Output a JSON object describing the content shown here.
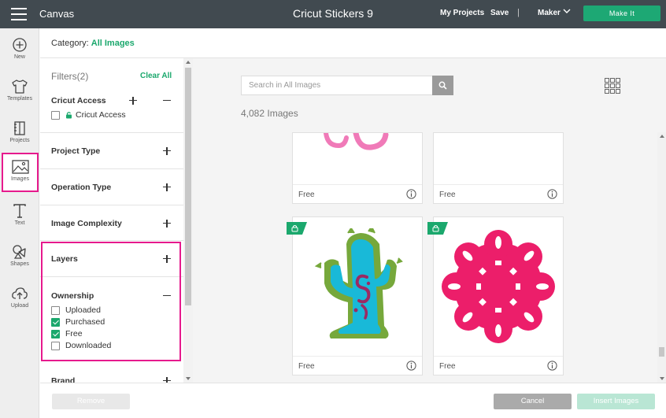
{
  "topbar": {
    "app_name": "Canvas",
    "doc_title": "Cricut Stickers 9",
    "my_projects": "My Projects",
    "save": "Save",
    "separator": "|",
    "machine": "Maker",
    "make_it": "Make It"
  },
  "rail": {
    "items": [
      {
        "label": "New",
        "icon": "plus-circle-icon"
      },
      {
        "label": "Templates",
        "icon": "shirt-icon"
      },
      {
        "label": "Projects",
        "icon": "notebook-icon"
      },
      {
        "label": "Images",
        "icon": "image-icon",
        "active": true
      },
      {
        "label": "Text",
        "icon": "text-icon"
      },
      {
        "label": "Shapes",
        "icon": "shapes-icon"
      },
      {
        "label": "Upload",
        "icon": "cloud-upload-icon"
      }
    ]
  },
  "category": {
    "label": "Category:",
    "value": "All Images"
  },
  "filters": {
    "title": "Filters(2)",
    "clear_all": "Clear All",
    "cricut_access": {
      "title": "Cricut Access",
      "option": "Cricut Access",
      "checked": false
    },
    "project_type": "Project Type",
    "operation_type": "Operation Type",
    "image_complexity": "Image Complexity",
    "layers": "Layers",
    "ownership": {
      "title": "Ownership",
      "options": [
        {
          "label": "Uploaded",
          "checked": false
        },
        {
          "label": "Purchased",
          "checked": true
        },
        {
          "label": "Free",
          "checked": true
        },
        {
          "label": "Downloaded",
          "checked": false
        }
      ]
    },
    "brand": "Brand"
  },
  "main": {
    "search_placeholder": "Search in All Images",
    "count": "4,082 Images",
    "tiles": [
      {
        "label": "Free"
      },
      {
        "label": "Free"
      },
      {
        "label": "Free"
      },
      {
        "label": "Free"
      }
    ]
  },
  "actions": {
    "remove": "Remove",
    "cancel": "Cancel",
    "insert": "Insert Images"
  },
  "colors": {
    "accent_green": "#1ba86d",
    "highlight_pink": "#e61a8d",
    "topbar": "#414a50"
  }
}
